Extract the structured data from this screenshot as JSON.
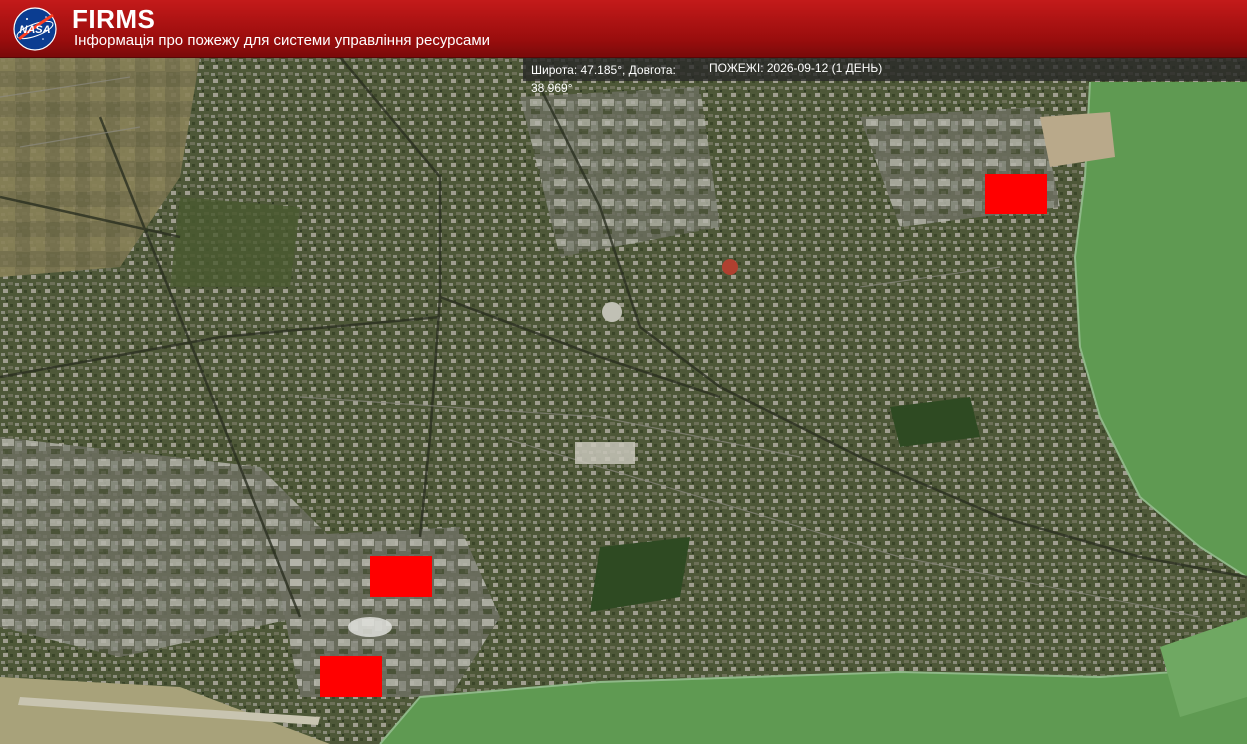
{
  "header": {
    "logo_text": "NASA",
    "title": "FIRMS",
    "subtitle": "Інформація про пожежу для системи управління ресурсами"
  },
  "infobar": {
    "coordinates": "Широта: 47.185°, Довгота: 38.969°",
    "fires": "ПОЖЕЖІ: 2026-09-12 (1 ДЕНЬ)"
  },
  "map": {
    "imagery": "satellite",
    "fire_marker_color": "#ff0000",
    "water_color": "#5f9a52",
    "fire_count": 3
  }
}
